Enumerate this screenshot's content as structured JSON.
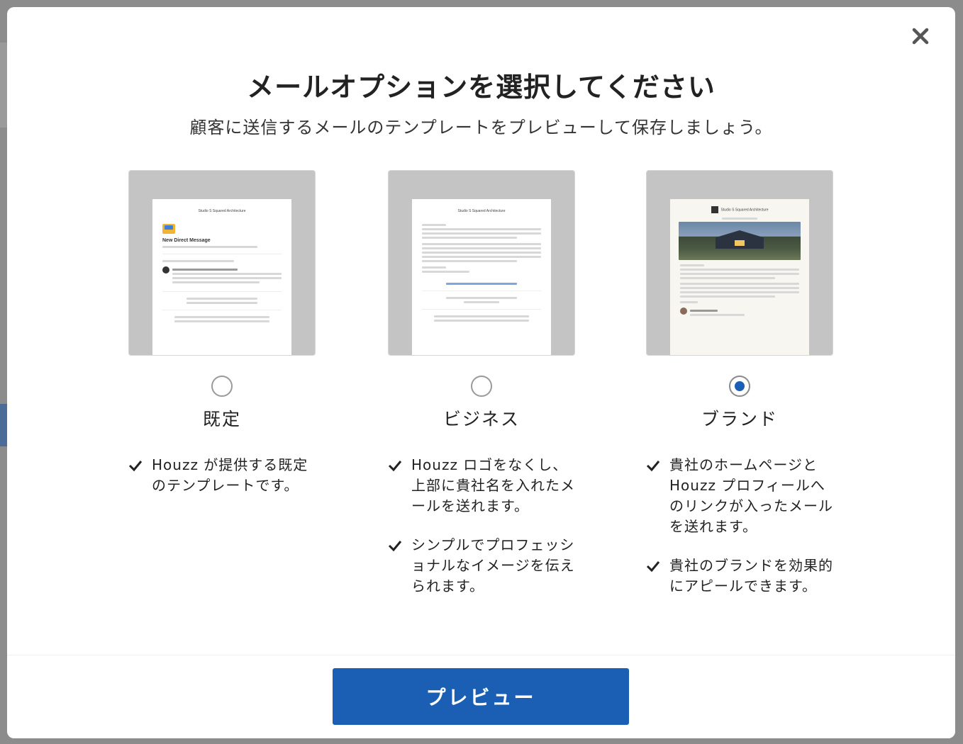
{
  "modal": {
    "title": "メールオプションを選択してください",
    "subtitle": "顧客に送信するメールのテンプレートをプレビューして保存しましょう。",
    "close_icon": "close-icon"
  },
  "options": [
    {
      "name": "既定",
      "selected": false,
      "features": [
        "Houzz が提供する既定のテンプレートです。"
      ],
      "thumbnail": {
        "company": "Studio S Squared Architecture",
        "heading": "New Direct Message"
      }
    },
    {
      "name": "ビジネス",
      "selected": false,
      "features": [
        "Houzz ロゴをなくし、上部に貴社名を入れたメールを送れます。",
        "シンプルでプロフェッショナルなイメージを伝えられます。"
      ],
      "thumbnail": {
        "company": "Studio S Squared Architecture"
      }
    },
    {
      "name": "ブランド",
      "selected": true,
      "features": [
        "貴社のホームページと Houzz プロフィールへのリンクが入ったメールを送れます。",
        "貴社のブランドを効果的にアピールできます。"
      ],
      "thumbnail": {
        "company": "Studio S Squared Architecture"
      }
    }
  ],
  "footer": {
    "preview_label": "プレビュー"
  },
  "colors": {
    "accent": "#1a5fb4",
    "thumb_bg": "#c4c4c4"
  }
}
